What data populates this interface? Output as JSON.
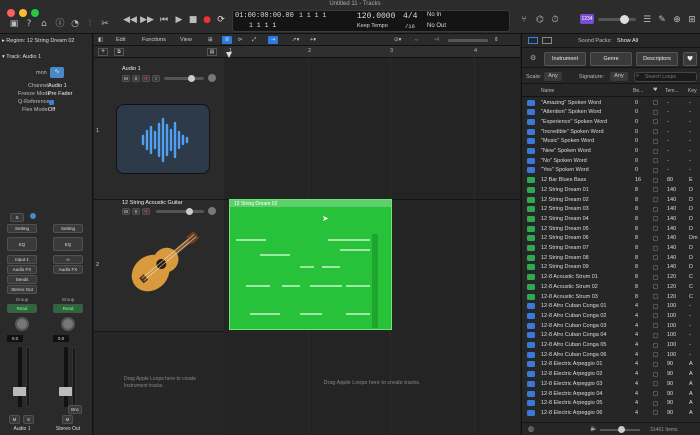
{
  "window": {
    "title": "Untitled 11 - Tracks"
  },
  "lcd": {
    "position": "01:00:00:00.00",
    "bars": "1  1  1  1",
    "beats": "1  1  1  1",
    "tempo": "120.0000",
    "tempo_label": "Keep Tempo",
    "sig_top": "4/4",
    "sig_bottom": "/16",
    "in": "No In",
    "out": "No Out"
  },
  "toolbar_badge": "1234",
  "inspector": {
    "region": "Region: 12 String Dream 02",
    "track": "Track: Audio 1",
    "mon": "mon",
    "channel_label": "Channel:",
    "channel_value": "Audio 1",
    "freeze_label": "Freeze Mode:",
    "freeze_value": "Pre Fader",
    "qref_label": "Q-Reference:",
    "flex_label": "Flex Mode:",
    "flex_value": "Off",
    "strip1": {
      "s": "S",
      "setting": "Setting",
      "eq": "EQ",
      "input": "Input 1",
      "fx": "Audio FX",
      "sends": "Sends",
      "out": "Stereo Out",
      "group": "Group",
      "read": "Read",
      "val": "0.0",
      "m": "M",
      "s2": "S",
      "name": "Audio 1"
    },
    "strip2": {
      "setting": "Setting",
      "eq": "EQ",
      "link": "∞",
      "fx": "Audio FX",
      "group": "Group",
      "read": "Read",
      "val": "0.0",
      "bnc": "Bnc",
      "m": "M",
      "name": "Stereo Out"
    }
  },
  "tracks_toolbar": {
    "edit": "Edit",
    "functions": "Functions",
    "view": "View"
  },
  "ruler": [
    "1",
    "2",
    "3",
    "4"
  ],
  "tracks": [
    {
      "num": "1",
      "name": "Audio 1",
      "m": "M",
      "s": "S",
      "r": "R",
      "i": "I"
    },
    {
      "num": "2",
      "name": "12 String Acoustic Guitar",
      "m": "M",
      "s": "S",
      "r": "R"
    }
  ],
  "region": {
    "name": "12 String Dream 02"
  },
  "drag_hint_left": "Drag Apple Loops here to create Instrument tracks.",
  "drag_hint_main": "Drag Apple Loops here to create tracks.",
  "browser": {
    "sound_packs_label": "Sound Packs:",
    "sound_packs_value": "Show All",
    "tabs": [
      "Instrument",
      "Genre",
      "Descriptors"
    ],
    "scale_label": "Scale:",
    "scale_value": "Any",
    "signature_label": "Signature:",
    "signature_value": "Any",
    "search_placeholder": "Search Loops",
    "columns": {
      "name": "Name",
      "beats": "Be...",
      "tempo": "Tem...",
      "key": "Key"
    },
    "items_count": "31461 Items",
    "loops": [
      {
        "name": "\"Amazing\" Spoken Word",
        "beats": "0",
        "tempo": "-",
        "key": "-",
        "type": "audio"
      },
      {
        "name": "\"Attention\" Spoken Word",
        "beats": "0",
        "tempo": "-",
        "key": "-",
        "type": "audio"
      },
      {
        "name": "\"Experience\" Spoken Word",
        "beats": "0",
        "tempo": "-",
        "key": "-",
        "type": "audio"
      },
      {
        "name": "\"Incredible\" Spoken Word",
        "beats": "0",
        "tempo": "-",
        "key": "-",
        "type": "audio"
      },
      {
        "name": "\"Music\" Spoken Word",
        "beats": "0",
        "tempo": "-",
        "key": "-",
        "type": "audio"
      },
      {
        "name": "\"New\" Spoken Word",
        "beats": "0",
        "tempo": "-",
        "key": "-",
        "type": "audio"
      },
      {
        "name": "\"No\" Spoken Word",
        "beats": "0",
        "tempo": "-",
        "key": "-",
        "type": "audio"
      },
      {
        "name": "\"Yes\" Spoken Word",
        "beats": "0",
        "tempo": "-",
        "key": "-",
        "type": "audio"
      },
      {
        "name": "12 Bar Blues Bass",
        "beats": "16",
        "tempo": "80",
        "key": "E",
        "type": "midi"
      },
      {
        "name": "12 String Dream 01",
        "beats": "8",
        "tempo": "140",
        "key": "D",
        "type": "midi"
      },
      {
        "name": "12 String Dream 02",
        "beats": "8",
        "tempo": "140",
        "key": "D",
        "type": "midi"
      },
      {
        "name": "12 String Dream 03",
        "beats": "8",
        "tempo": "140",
        "key": "D",
        "type": "midi"
      },
      {
        "name": "12 String Dream 04",
        "beats": "8",
        "tempo": "140",
        "key": "D",
        "type": "midi"
      },
      {
        "name": "12 String Dream 05",
        "beats": "8",
        "tempo": "140",
        "key": "D",
        "type": "midi"
      },
      {
        "name": "12 String Dream 06",
        "beats": "8",
        "tempo": "140",
        "key": "Dm",
        "type": "midi"
      },
      {
        "name": "12 String Dream 07",
        "beats": "8",
        "tempo": "140",
        "key": "D",
        "type": "midi"
      },
      {
        "name": "12 String Dream 08",
        "beats": "8",
        "tempo": "140",
        "key": "D",
        "type": "midi"
      },
      {
        "name": "12 String Dream 09",
        "beats": "8",
        "tempo": "140",
        "key": "D",
        "type": "midi"
      },
      {
        "name": "12-8 Acoustic Strum 01",
        "beats": "8",
        "tempo": "120",
        "key": "C",
        "type": "midi"
      },
      {
        "name": "12-8 Acoustic Strum 02",
        "beats": "8",
        "tempo": "120",
        "key": "C",
        "type": "midi"
      },
      {
        "name": "12-8 Acoustic Strum 03",
        "beats": "8",
        "tempo": "120",
        "key": "C",
        "type": "midi"
      },
      {
        "name": "12-8 Afro Cuban Conga 01",
        "beats": "4",
        "tempo": "100",
        "key": "-",
        "type": "audio"
      },
      {
        "name": "12-8 Afro Cuban Conga 02",
        "beats": "4",
        "tempo": "100",
        "key": "-",
        "type": "audio"
      },
      {
        "name": "12-8 Afro Cuban Conga 03",
        "beats": "4",
        "tempo": "100",
        "key": "-",
        "type": "audio"
      },
      {
        "name": "12-8 Afro Cuban Conga 04",
        "beats": "4",
        "tempo": "100",
        "key": "-",
        "type": "audio"
      },
      {
        "name": "12-8 Afro Cuban Conga 05",
        "beats": "4",
        "tempo": "100",
        "key": "-",
        "type": "audio"
      },
      {
        "name": "12-8 Afro Cuban Conga 06",
        "beats": "4",
        "tempo": "100",
        "key": "-",
        "type": "audio"
      },
      {
        "name": "12-8 Electric Arpeggio 01",
        "beats": "4",
        "tempo": "90",
        "key": "A",
        "type": "audio"
      },
      {
        "name": "12-8 Electric Arpeggio 02",
        "beats": "4",
        "tempo": "90",
        "key": "A",
        "type": "audio"
      },
      {
        "name": "12-8 Electric Arpeggio 03",
        "beats": "4",
        "tempo": "90",
        "key": "A",
        "type": "audio"
      },
      {
        "name": "12-8 Electric Arpeggio 04",
        "beats": "4",
        "tempo": "90",
        "key": "A",
        "type": "audio"
      },
      {
        "name": "12-8 Electric Arpeggio 05",
        "beats": "4",
        "tempo": "90",
        "key": "A",
        "type": "audio"
      },
      {
        "name": "12-8 Electric Arpeggio 06",
        "beats": "4",
        "tempo": "90",
        "key": "A",
        "type": "audio"
      }
    ]
  },
  "colors": {
    "region_green": "#27c13a",
    "accent_blue": "#2c7ce0",
    "midi_green": "#2fa84f",
    "audio_blue": "#3a78d8"
  }
}
